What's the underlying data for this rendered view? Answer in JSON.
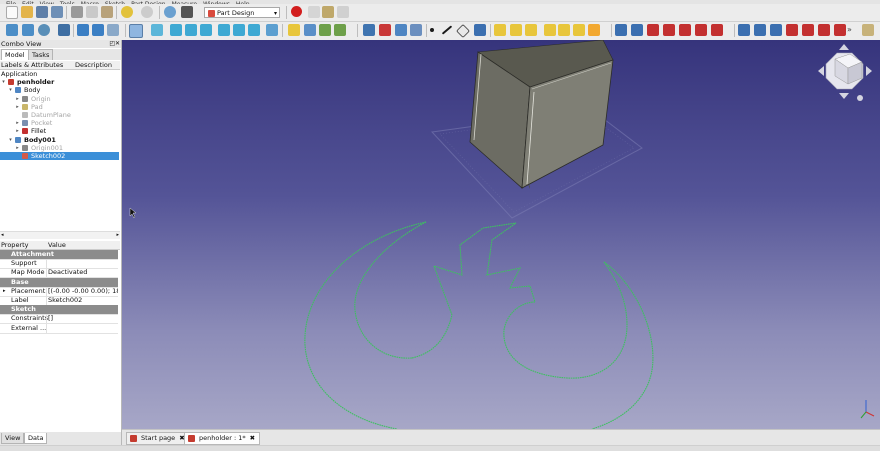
{
  "menubar": [
    "File",
    "Edit",
    "View",
    "Tools",
    "Macro",
    "Sketch",
    "Part Design",
    "Measure",
    "Windows",
    "Help"
  ],
  "toolbar": {
    "workbench": "Part Design"
  },
  "combo": {
    "title": "Combo View",
    "tabs": [
      "Model",
      "Tasks"
    ],
    "tree_headers": [
      "Labels & Attributes",
      "Description"
    ],
    "tree": [
      {
        "label": "Application",
        "depth": 0,
        "twisty": "",
        "icon": "",
        "style": "normal"
      },
      {
        "label": "penholder",
        "depth": 1,
        "twisty": "▾",
        "icon": "document-icon",
        "style": "bold"
      },
      {
        "label": "Body",
        "depth": 2,
        "twisty": "▾",
        "icon": "body-icon",
        "style": "normal"
      },
      {
        "label": "Origin",
        "depth": 3,
        "twisty": "▸",
        "icon": "origin-icon",
        "style": "dim"
      },
      {
        "label": "Pad",
        "depth": 3,
        "twisty": "▸",
        "icon": "pad-icon",
        "style": "dim"
      },
      {
        "label": "DatumPlane",
        "depth": 3,
        "twisty": "",
        "icon": "datum-plane-icon",
        "style": "dim"
      },
      {
        "label": "Pocket",
        "depth": 3,
        "twisty": "▸",
        "icon": "pocket-icon",
        "style": "dim"
      },
      {
        "label": "Fillet",
        "depth": 3,
        "twisty": "▸",
        "icon": "fillet-icon",
        "style": "normal"
      },
      {
        "label": "Body001",
        "depth": 2,
        "twisty": "▾",
        "icon": "body-icon",
        "style": "bold"
      },
      {
        "label": "Origin001",
        "depth": 3,
        "twisty": "▸",
        "icon": "origin-icon",
        "style": "dim"
      },
      {
        "label": "Sketch002",
        "depth": 3,
        "twisty": "",
        "icon": "sketch-icon",
        "style": "selected"
      }
    ],
    "prop_headers": [
      "Property",
      "Value"
    ],
    "properties": [
      {
        "group": "Attachment"
      },
      {
        "name": "Support",
        "value": ""
      },
      {
        "name": "Map Mode",
        "value": "Deactivated"
      },
      {
        "group": "Base"
      },
      {
        "name": "Placement",
        "value": "[(-0.00 -0.00 0.00); 18...",
        "expand": "▸"
      },
      {
        "name": "Label",
        "value": "Sketch002"
      },
      {
        "group": "Sketch"
      },
      {
        "name": "Constraints",
        "value": "[]"
      },
      {
        "name": "External ...",
        "value": ""
      }
    ],
    "bottom_tabs": [
      "View",
      "Data"
    ]
  },
  "doc_tabs": [
    {
      "label": "Start page",
      "close": "✖"
    },
    {
      "label": "penholder : 1*",
      "close": "✖"
    }
  ],
  "colors": {
    "sketch_line": "#3ec060",
    "box_face_left": "#6b6b62",
    "box_face_right": "#7d7d73",
    "selection": "#3b8fd8"
  }
}
